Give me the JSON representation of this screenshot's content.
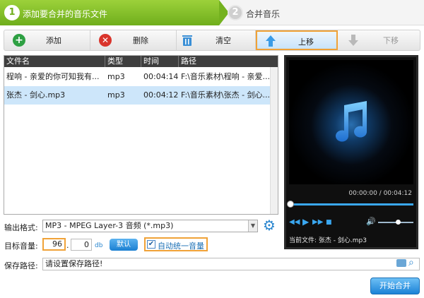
{
  "steps": {
    "step1": {
      "num": "1",
      "label": "添加要合并的音乐文件"
    },
    "step2": {
      "num": "2",
      "label": "合并音乐"
    }
  },
  "toolbar": {
    "add": {
      "icon": "plus-icon",
      "label": "添加"
    },
    "delete": {
      "icon": "delete-icon",
      "label": "删除"
    },
    "clear": {
      "icon": "trash-icon",
      "label": "清空"
    },
    "up": {
      "icon": "arrow-up-icon",
      "label": "上移"
    },
    "down": {
      "icon": "arrow-down-icon",
      "label": "下移"
    }
  },
  "list": {
    "columns": [
      "文件名",
      "类型",
      "时间",
      "路径"
    ],
    "rows": [
      {
        "name": "程响 - 亲爱的你可知我有...",
        "type": "mp3",
        "time": "00:04:14",
        "path": "F:\\音乐素材\\程响 - 亲爱..."
      },
      {
        "name": "张杰 - 剑心.mp3",
        "type": "mp3",
        "time": "00:04:12",
        "path": "F:\\音乐素材\\张杰 - 剑心..."
      }
    ]
  },
  "player": {
    "time": "00:00:00 / 00:04:12",
    "current_label": "当前文件:",
    "current_file": "张杰 - 剑心.mp3",
    "progress": 0,
    "volume": 0.55
  },
  "form": {
    "format_label": "输出格式:",
    "format_value": "MP3 - MPEG Layer-3 音频 (*.mp3)",
    "target_label": "目标音量:",
    "target_value": "96",
    "db_value": "0",
    "db_unit": "db",
    "default_btn": "默认",
    "auto_label": "自动统一音量",
    "auto_checked": true,
    "save_label": "保存路径:",
    "save_placeholder": "请设置保存路径!"
  },
  "start_button": "开始合并",
  "colors": {
    "accent_green": "#6fae1c",
    "accent_blue": "#1b82d6",
    "highlight_orange": "#f0a238",
    "selected_row": "#cde6fa"
  }
}
